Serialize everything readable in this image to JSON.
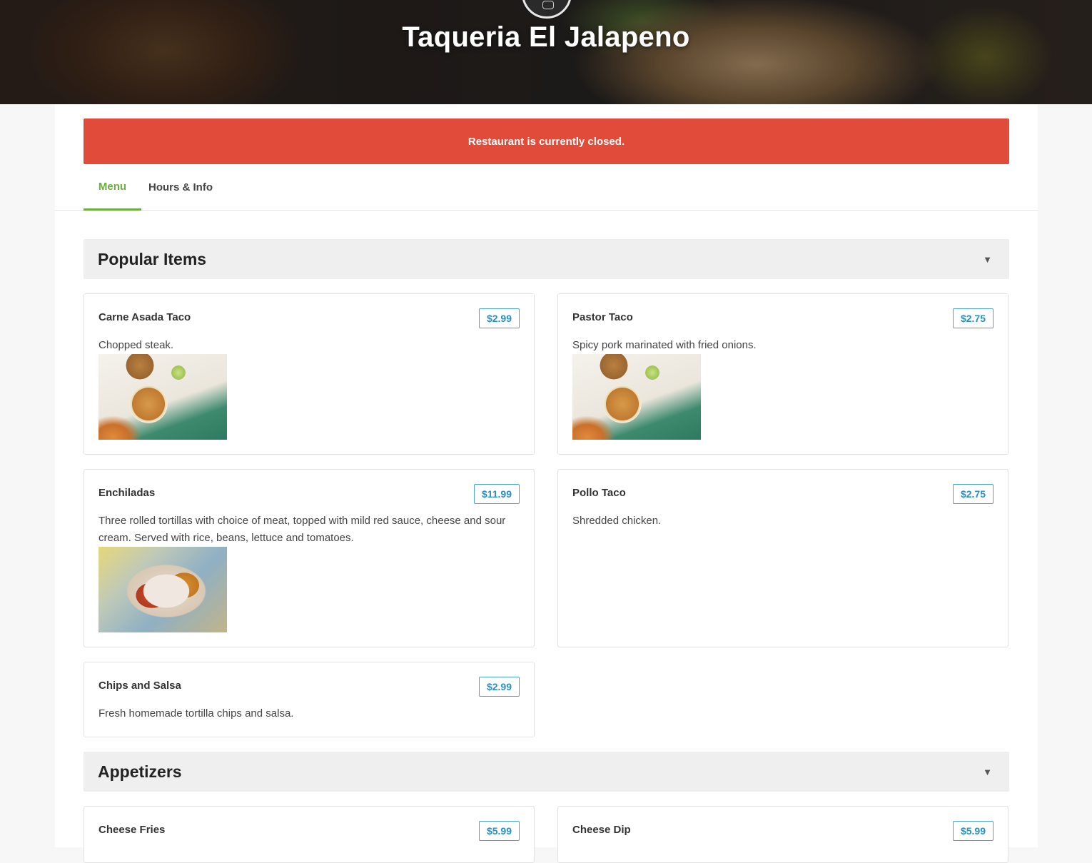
{
  "restaurant": {
    "name": "Taqueria El Jalapeno"
  },
  "alert": {
    "message": "Restaurant is currently closed."
  },
  "tabs": [
    {
      "label": "Menu",
      "active": true
    },
    {
      "label": "Hours & Info",
      "active": false
    }
  ],
  "colors": {
    "accent": "#6aaf3d",
    "alert": "#e04b3a",
    "price": "#2c8fc2"
  },
  "sections": [
    {
      "title": "Popular Items",
      "toggle_icon": "chevron-down-icon",
      "items": [
        {
          "name": "Carne Asada Taco",
          "price": "$2.99",
          "description": "Chopped steak.",
          "image": "taco-photo"
        },
        {
          "name": "Pastor Taco",
          "price": "$2.75",
          "description": "Spicy pork marinated with fried onions.",
          "image": "taco-photo"
        },
        {
          "name": "Enchiladas",
          "price": "$11.99",
          "description": "Three rolled tortillas with choice of meat, topped with mild red sauce, cheese and sour cream. Served with rice, beans, lettuce and tomatoes.",
          "image": "enchilada-photo"
        },
        {
          "name": "Pollo Taco",
          "price": "$2.75",
          "description": "Shredded chicken."
        },
        {
          "name": "Chips and Salsa",
          "price": "$2.99",
          "description": "Fresh homemade tortilla chips and salsa."
        }
      ]
    },
    {
      "title": "Appetizers",
      "toggle_icon": "chevron-down-icon",
      "items": [
        {
          "name": "Cheese Fries",
          "price": "$5.99"
        },
        {
          "name": "Cheese Dip",
          "price": "$5.99"
        }
      ]
    }
  ]
}
